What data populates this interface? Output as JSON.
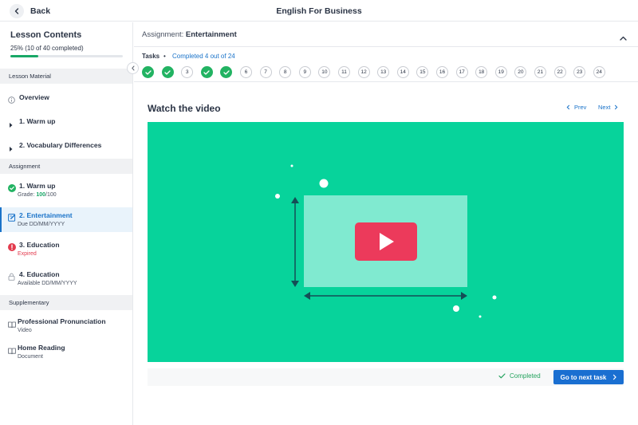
{
  "header": {
    "back_label": "Back",
    "title": "English For Business"
  },
  "sidebar": {
    "heading": "Lesson Contents",
    "progress_text": "25% (10 of 40 completed)",
    "progress_value": 0.25,
    "sections": {
      "lesson_material": "Lesson Material",
      "assignment": "Assignment",
      "supplementary": "Supplementary"
    },
    "lesson_items": [
      {
        "label": "Overview",
        "icon": "info-icon"
      },
      {
        "label": "1. Warm up",
        "icon": "chevron-right-icon"
      },
      {
        "label": "2. Vocabulary Differences",
        "icon": "chevron-right-icon"
      }
    ],
    "assignments": [
      {
        "label": "1. Warm up",
        "grade_prefix": "Grade: ",
        "grade_value": "100",
        "grade_suffix": "/100",
        "icon": "check-circle-icon"
      },
      {
        "label": "2. Entertainment",
        "sub": "Due DD/MM/YYYY",
        "icon": "edit-icon"
      },
      {
        "label": "3. Education",
        "sub": "Expired",
        "icon": "alert-icon"
      },
      {
        "label": "4. Education",
        "sub": "Available DD/MM/YYYY",
        "icon": "lock-icon"
      }
    ],
    "supplementary": [
      {
        "label": "Professional Pronunciation",
        "sub": "Video",
        "icon": "book-icon"
      },
      {
        "label": "Home Reading",
        "sub": "Document",
        "icon": "book-icon"
      }
    ]
  },
  "assignment": {
    "prefix": "Assignment: ",
    "name": "Entertainment"
  },
  "tasks": {
    "label": "Tasks",
    "separator": "•",
    "completed_text": "Completed 4 out of 24",
    "items": [
      {
        "num": "1",
        "done": true
      },
      {
        "num": "2",
        "done": true
      },
      {
        "num": "3",
        "done": false
      },
      {
        "num": "4",
        "done": true
      },
      {
        "num": "5",
        "done": true
      },
      {
        "num": "6",
        "done": false
      },
      {
        "num": "7",
        "done": false
      },
      {
        "num": "8",
        "done": false
      },
      {
        "num": "9",
        "done": false
      },
      {
        "num": "10",
        "done": false
      },
      {
        "num": "11",
        "done": false
      },
      {
        "num": "12",
        "done": false
      },
      {
        "num": "13",
        "done": false
      },
      {
        "num": "14",
        "done": false
      },
      {
        "num": "15",
        "done": false
      },
      {
        "num": "16",
        "done": false
      },
      {
        "num": "17",
        "done": false
      },
      {
        "num": "18",
        "done": false
      },
      {
        "num": "19",
        "done": false
      },
      {
        "num": "20",
        "done": false
      },
      {
        "num": "21",
        "done": false
      },
      {
        "num": "22",
        "done": false
      },
      {
        "num": "23",
        "done": false
      },
      {
        "num": "24",
        "done": false
      }
    ]
  },
  "content": {
    "title": "Watch the video",
    "prev_label": "Prev",
    "next_label": "Next",
    "completed_label": "Completed",
    "next_task_label": "Go to next task"
  },
  "colors": {
    "accent": "#1a73c9",
    "success": "#22b362",
    "danger": "#e33b4e",
    "video_bg": "#07d39b",
    "play_button": "#ec3a5b"
  }
}
